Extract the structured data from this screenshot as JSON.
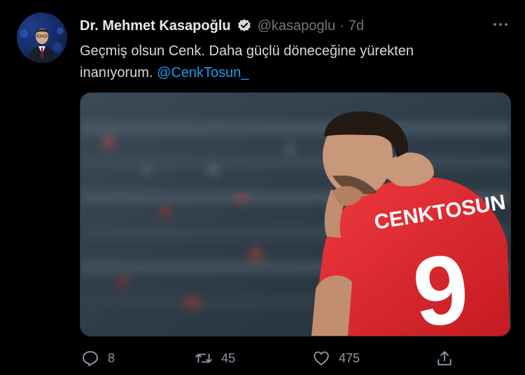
{
  "tweet": {
    "author_name": "Dr. Mehmet Kasapoğlu",
    "handle": "@kasapoglu",
    "separator": "·",
    "time": "7d",
    "text_main": "Geçmiş olsun Cenk. Daha güçlü döneceğine yürekten inanıyorum.",
    "mention": "@CenkTosun_",
    "media": {
      "jersey_name": "CENKTOSUN",
      "jersey_number": "9"
    },
    "actions": {
      "reply_count": "8",
      "retweet_count": "45",
      "like_count": "475"
    }
  },
  "icons": {
    "verified": "verified-badge-icon",
    "more": "more-options-icon",
    "reply": "reply-icon",
    "retweet": "retweet-icon",
    "like": "heart-icon",
    "share": "share-icon"
  },
  "colors": {
    "background": "#000000",
    "text": "#d9d9d9",
    "muted": "#6e767d",
    "link": "#1d9bf0",
    "jersey": "#e3262c"
  }
}
